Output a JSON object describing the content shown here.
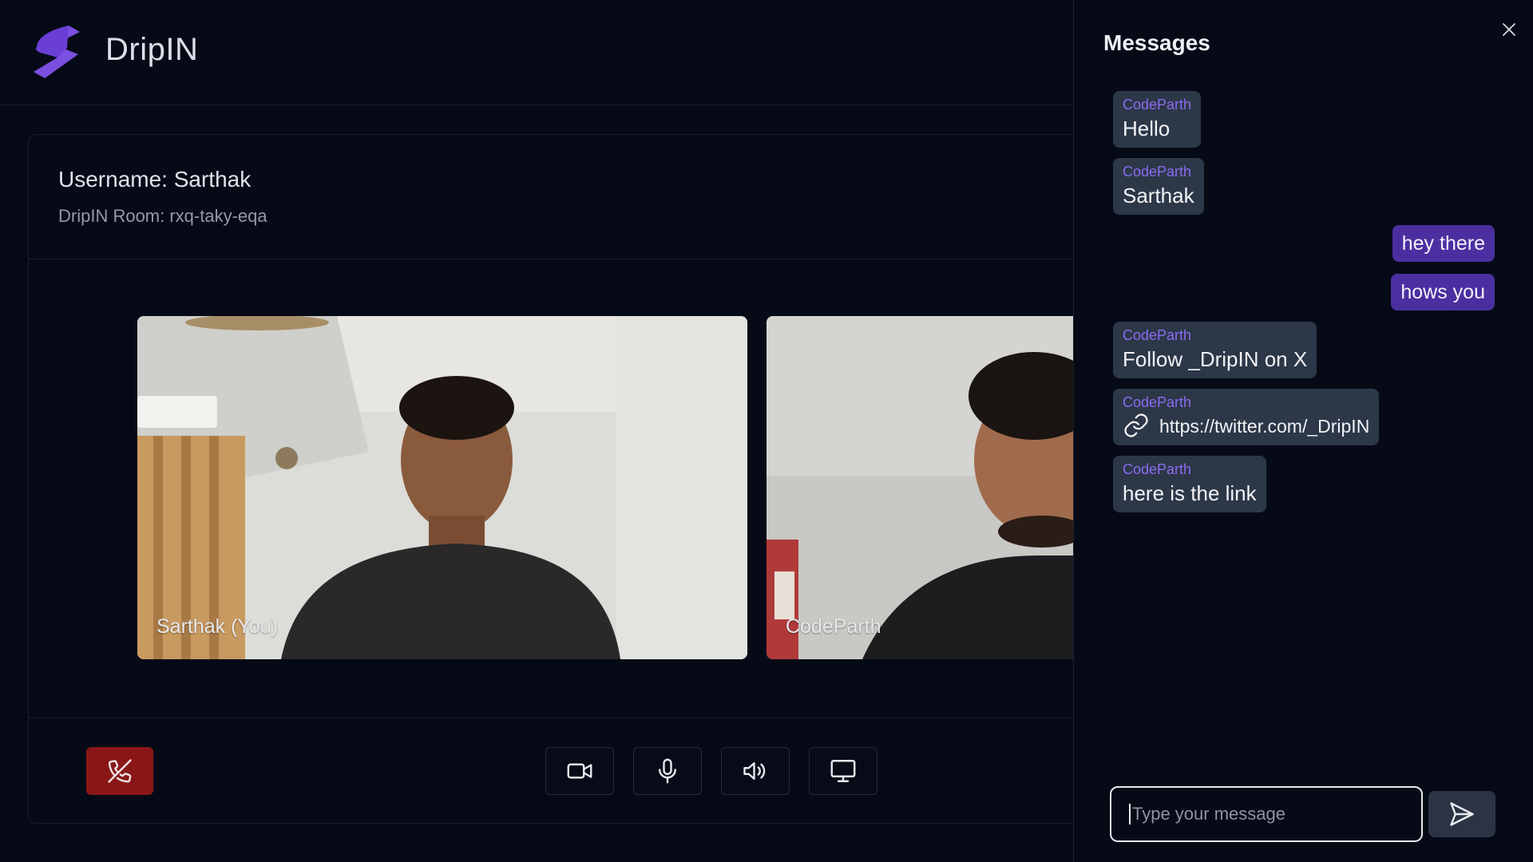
{
  "app": {
    "brand": "DripIN",
    "logo_icon": "bolt-logo-icon",
    "accent": "#7b4fe0"
  },
  "room_info": {
    "username": "Username: Sarthak",
    "room": "DripIN Room: rxq-taky-eqa"
  },
  "videos": [
    {
      "name": "Sarthak (You)"
    },
    {
      "name": "CodeParth"
    }
  ],
  "controls": [
    {
      "name": "end-call",
      "icon": "phone-off-icon",
      "color": "#8a1717"
    },
    {
      "name": "camera",
      "icon": "video-camera-icon"
    },
    {
      "name": "microphone",
      "icon": "microphone-icon"
    },
    {
      "name": "speaker",
      "icon": "speaker-icon"
    },
    {
      "name": "screen-share",
      "icon": "monitor-icon"
    }
  ],
  "messages_panel": {
    "title": "Messages",
    "close_icon": "close-icon",
    "messages": [
      {
        "sender": "CodeParth",
        "text": "Hello",
        "mine": false
      },
      {
        "sender": "CodeParth",
        "text": "Sarthak",
        "mine": false
      },
      {
        "sender": "",
        "text": "hey there",
        "mine": true
      },
      {
        "sender": "",
        "text": "hows you",
        "mine": true
      },
      {
        "sender": "CodeParth",
        "text": "Follow _DripIN on X",
        "mine": false
      },
      {
        "sender": "CodeParth",
        "text": "https://twitter.com/_DripIN",
        "mine": false,
        "is_link": true,
        "icon": "link-icon"
      },
      {
        "sender": "CodeParth",
        "text": "here is the link",
        "mine": false
      }
    ],
    "input_placeholder": "Type your message",
    "input_value": "",
    "send_icon": "send-icon"
  },
  "colors": {
    "background": "#060a17",
    "incoming_bubble": "#2c3748",
    "outgoing_bubble": "#4b2fa0",
    "sender_name": "#8b6cf0"
  }
}
